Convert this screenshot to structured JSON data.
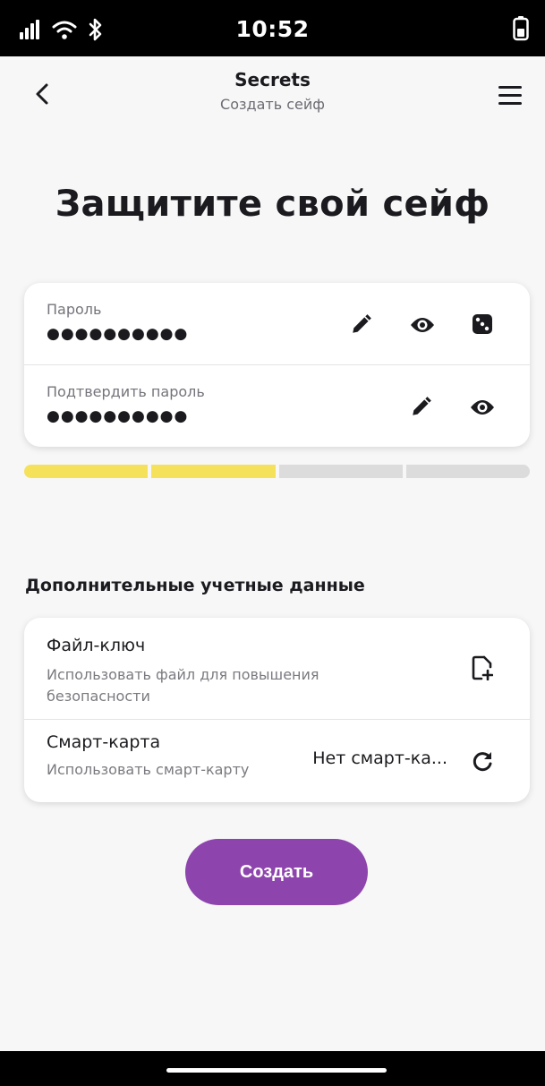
{
  "status_bar": {
    "time": "10:52",
    "icons": [
      "signal-icon",
      "wifi-icon",
      "bluetooth-icon",
      "battery-icon"
    ]
  },
  "app_bar": {
    "title": "Secrets",
    "subtitle": "Создать сейф",
    "back_icon": "chevron-left-icon",
    "menu_icon": "menu-icon"
  },
  "headline": "Защитите свой сейф",
  "password": {
    "label": "Пароль",
    "value": "●●●●●●●●●●",
    "icons": [
      "edit-icon",
      "visibility-icon",
      "dice-icon"
    ]
  },
  "confirm": {
    "label": "Подтвердить пароль",
    "value": "●●●●●●●●●●",
    "icons": [
      "edit-icon",
      "visibility-icon"
    ]
  },
  "strength": {
    "filled_segments": 2,
    "total_segments": 4,
    "color": "#f6e15a"
  },
  "extra": {
    "title": "Дополнительные учетные данные",
    "key_file": {
      "title": "Файл-ключ",
      "subtitle": "Использовать файл для повышения безопасности",
      "icon": "add-file-icon"
    },
    "smart_card": {
      "title": "Смарт-карта",
      "subtitle": "Использовать смарт-карту",
      "value": "Нет смарт-ка...",
      "icon": "refresh-icon"
    }
  },
  "create_button": {
    "label": "Создать",
    "color": "#8e44ad"
  }
}
